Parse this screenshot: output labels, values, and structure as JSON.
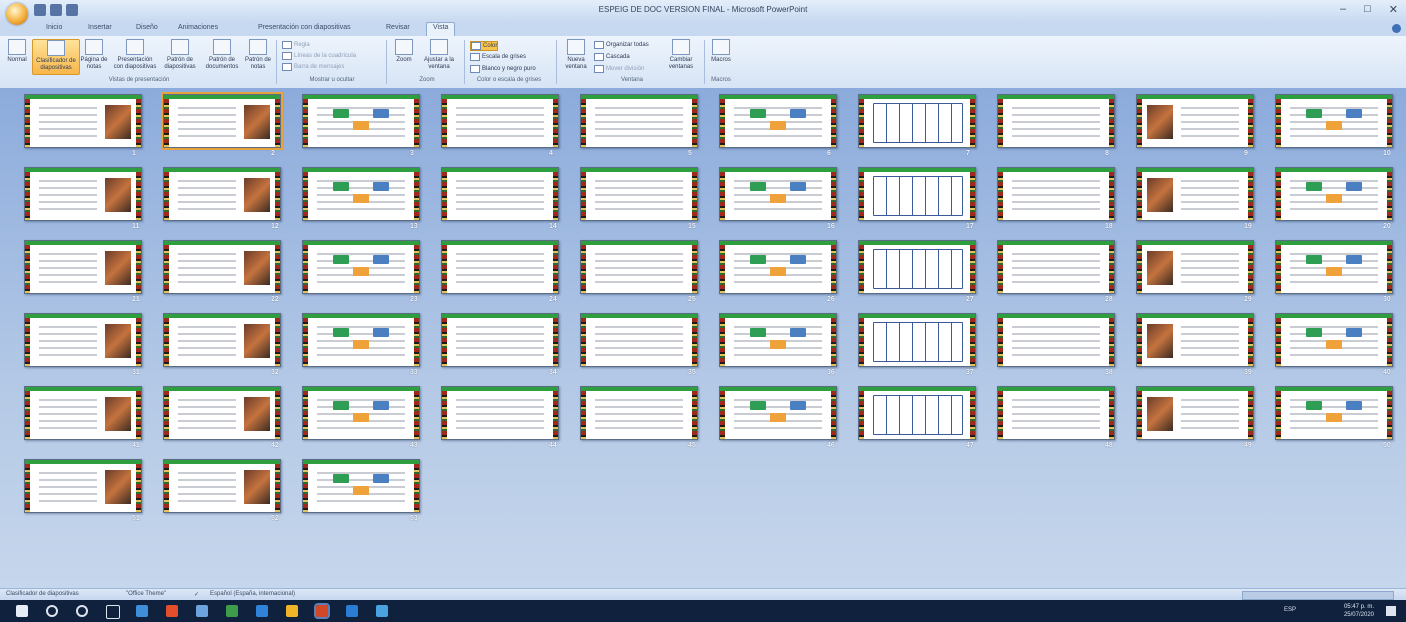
{
  "window": {
    "title": "ESPEIG DE DOC VERSION FINAL - Microsoft PowerPoint",
    "controls": [
      "–",
      "□",
      "✕"
    ]
  },
  "ribbon_tabs": [
    "Inicio",
    "Insertar",
    "Diseño",
    "Animaciones",
    "Presentación con diapositivas",
    "Revisar",
    "Vista"
  ],
  "ribbon_active_tab": "Vista",
  "ribbon": {
    "presentation_views": [
      "Normal",
      "Clasificador de diapositivas",
      "Página de notas",
      "Presentación con diapositivas",
      "Patrón de diapositivas",
      "Patrón de documentos",
      "Patrón de notas"
    ],
    "show_hide": [
      "Regla",
      "Líneas de la cuadrícula",
      "Barra de mensajes"
    ],
    "zoom": [
      "Zoom",
      "Ajustar a la ventana"
    ],
    "color": [
      "Color",
      "Escala de grises",
      "Blanco y negro puro"
    ],
    "window": [
      "Nueva ventana",
      "Organizar todas",
      "Cascada",
      "Mover división",
      "Cambiar ventanas"
    ],
    "macros": [
      "Macros"
    ],
    "group_labels": [
      "Vistas de presentación",
      "Mostrar u ocultar",
      "Zoom",
      "Color o escala de grises",
      "Ventana",
      "Macros"
    ]
  },
  "slides": [
    "1",
    "2",
    "3",
    "4",
    "5",
    "6",
    "7",
    "8",
    "9",
    "10",
    "11",
    "12",
    "13",
    "14",
    "15",
    "16",
    "17",
    "18",
    "19",
    "20",
    "21",
    "22",
    "23",
    "24",
    "25",
    "26",
    "27",
    "28",
    "29",
    "30",
    "31",
    "32",
    "33",
    "34",
    "35",
    "36",
    "37",
    "38",
    "39",
    "40",
    "41",
    "42",
    "43",
    "44",
    "45",
    "46",
    "47",
    "48",
    "49",
    "50",
    "51",
    "52",
    "53"
  ],
  "selected_slide": "2",
  "status_bar": {
    "view": "Clasificador de diapositivas",
    "theme": "\"Office Theme\"",
    "language": "Español (España, internacional)"
  },
  "taskbar": {
    "time": "05:47 p. m.",
    "date": "25/07/2020",
    "lang": "ESP"
  },
  "colors": {
    "accent_green": "#2e9e3e",
    "selection": "#e8a23b",
    "ribbon_bg": "#d6e4f5"
  }
}
